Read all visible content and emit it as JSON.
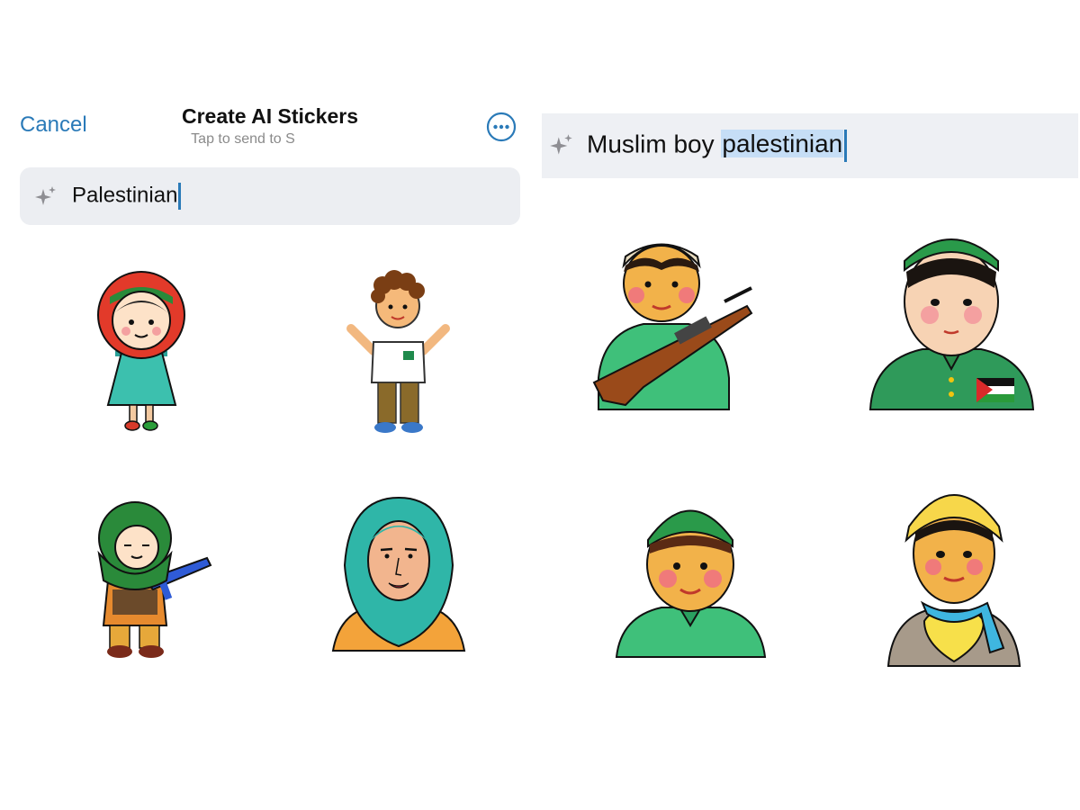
{
  "left_panel": {
    "cancel_label": "Cancel",
    "title": "Create AI Stickers",
    "subtitle": "Tap to send to S",
    "more_icon": "ellipsis-circle-icon",
    "search": {
      "icon": "sparkle-icon",
      "value": "Palestinian"
    },
    "stickers": [
      "girl-red-headscarf-sticker",
      "boy-curly-hair-sticker",
      "child-green-scarf-rifle-sticker",
      "woman-teal-hijab-sticker"
    ]
  },
  "right_panel": {
    "search": {
      "icon": "sparkle-icon",
      "value_plain": "Muslim boy ",
      "value_selected": "palestinian"
    },
    "stickers": [
      "boy-cap-rifle-sticker",
      "boy-green-cap-flag-sticker",
      "boy-green-kufi-sticker",
      "boy-yellow-turban-heart-sticker"
    ]
  },
  "colors": {
    "accent": "#2a7ab8",
    "search_bg": "#eceef2",
    "selection": "#c6def6"
  }
}
